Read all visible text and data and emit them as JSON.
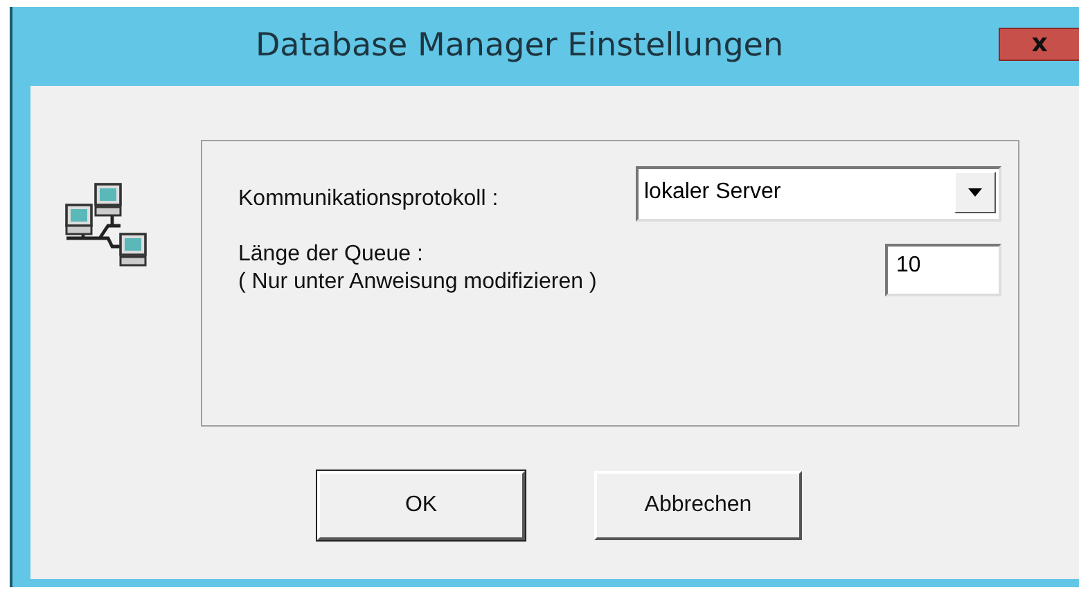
{
  "window": {
    "title": "Database Manager Einstellungen",
    "close": "x"
  },
  "settings": [
    {
      "kind": "dropdown",
      "label": "Kommunikationsprotokoll :",
      "value": "lokaler Server"
    },
    {
      "kind": "text",
      "label": "Länge der Queue :",
      "note": "( Nur unter Anweisung modifizieren )",
      "value": "10"
    }
  ],
  "buttons": [
    {
      "label": "OK",
      "default": true
    },
    {
      "label": "Abbrechen",
      "default": false
    }
  ]
}
